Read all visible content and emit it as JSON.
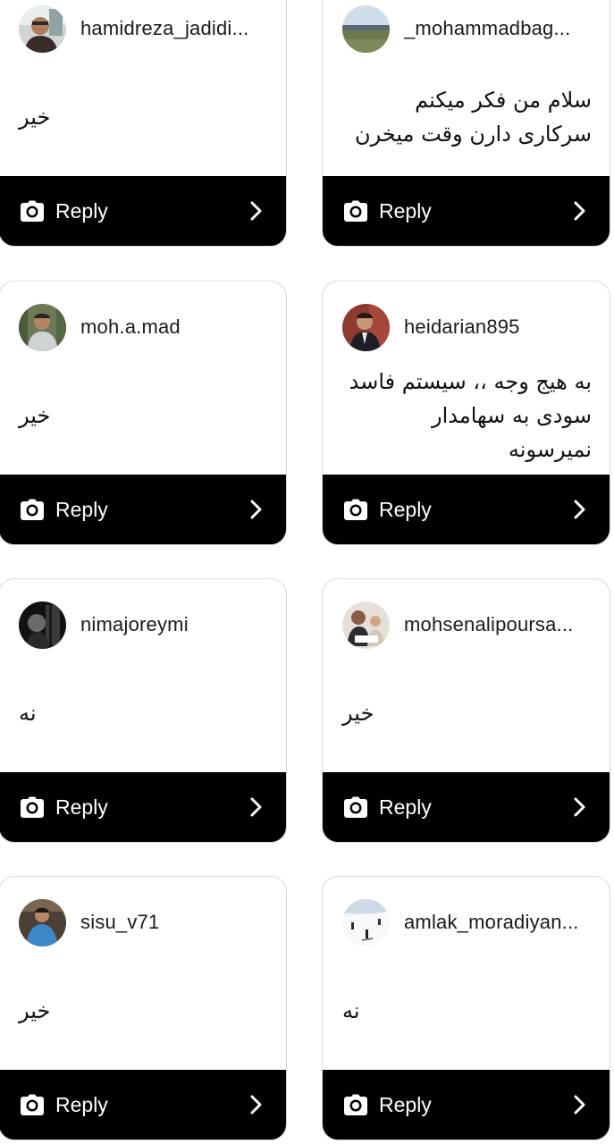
{
  "cards": [
    {
      "username": "hamidreza_jadidi...",
      "comment": "خیر",
      "reply_label": "Reply",
      "avatar": "avatar-man-glasses"
    },
    {
      "username": "_mohammadbag...",
      "comment": "سلام من فکر میکنم سرکاری دارن وقت میخرن",
      "reply_label": "Reply",
      "avatar": "avatar-landscape"
    },
    {
      "username": "moh.a.mad",
      "comment": "خیر",
      "reply_label": "Reply",
      "avatar": "avatar-man-trees"
    },
    {
      "username": "heidarian895",
      "comment": "به هیج وجه ،، سیستم فاسد سودی به سهامدار نمیرسونه",
      "reply_label": "Reply",
      "avatar": "avatar-man-suit"
    },
    {
      "username": "nimajoreymi",
      "comment": "نه",
      "reply_label": "Reply",
      "avatar": "avatar-dark-portrait"
    },
    {
      "username": "mohsenalipoursa...",
      "comment": "خیر",
      "reply_label": "Reply",
      "avatar": "avatar-man-child"
    },
    {
      "username": "sisu_v71",
      "comment": "خیر",
      "reply_label": "Reply",
      "avatar": "avatar-man-gym"
    },
    {
      "username": "amlak_moradiyan...",
      "comment": "نه",
      "reply_label": "Reply",
      "avatar": "avatar-ski-slope"
    }
  ],
  "icons": {
    "camera": "camera-icon",
    "chevron": "chevron-right-icon"
  },
  "colors": {
    "reply_bar": "#000000",
    "card_border": "#d9d9d9"
  }
}
